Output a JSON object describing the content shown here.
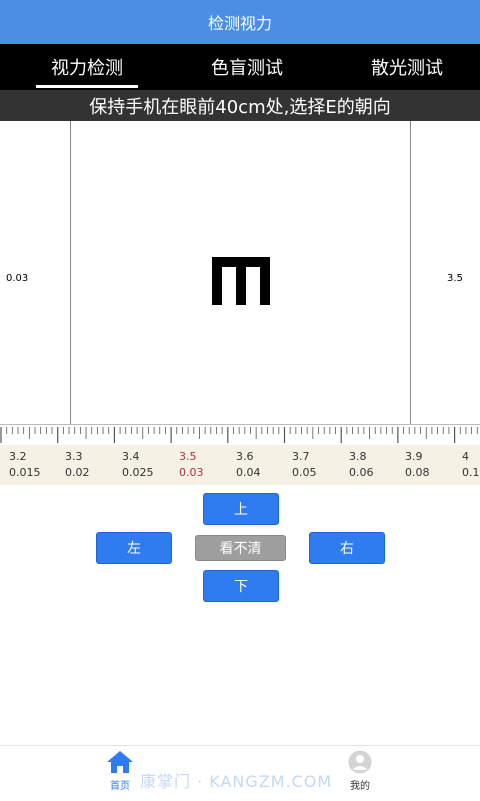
{
  "header": {
    "title": "检测视力"
  },
  "tabs": [
    {
      "label": "视力检测",
      "active": true
    },
    {
      "label": "色盲测试",
      "active": false
    },
    {
      "label": "散光测试",
      "active": false
    }
  ],
  "instruction": "保持手机在眼前40cm处,选择E的朝向",
  "test": {
    "left_value": "0.03",
    "right_value": "3.5",
    "optotype": "E",
    "optotype_direction": "down"
  },
  "scale": {
    "current_index": 3,
    "columns": [
      {
        "top": "3.2",
        "bottom": "0.015"
      },
      {
        "top": "3.3",
        "bottom": "0.02"
      },
      {
        "top": "3.4",
        "bottom": "0.025"
      },
      {
        "top": "3.5",
        "bottom": "0.03"
      },
      {
        "top": "3.6",
        "bottom": "0.04"
      },
      {
        "top": "3.7",
        "bottom": "0.05"
      },
      {
        "top": "3.8",
        "bottom": "0.06"
      },
      {
        "top": "3.9",
        "bottom": "0.08"
      },
      {
        "top": "4",
        "bottom": "0.1"
      }
    ]
  },
  "controls": {
    "up": "上",
    "left": "左",
    "unclear": "看不清",
    "right": "右",
    "down": "下"
  },
  "bottom_nav": {
    "home": {
      "label": "首页",
      "icon": "home-icon",
      "active": true
    },
    "mine": {
      "label": "我的",
      "icon": "user-icon",
      "active": false
    }
  },
  "watermark": "康掌门 · KANGZM.COM",
  "colors": {
    "header": "#4a8fe3",
    "tab_bar": "#000000",
    "instruction_bar": "#333333",
    "button_blue": "#2e7cf0",
    "button_gray": "#9e9e9e",
    "current_scale": "#b03050"
  }
}
